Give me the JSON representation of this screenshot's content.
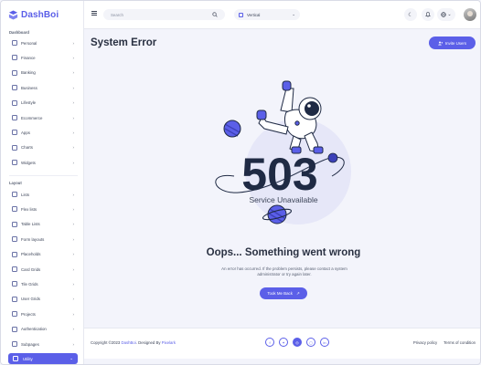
{
  "app": {
    "brand_prefix": "Dash",
    "brand_suffix": "Boi",
    "accent": "#5b5fe8"
  },
  "topbar": {
    "search_placeholder": "Search",
    "layout_value": "Vertical",
    "menu_icon": "hamburger-icon",
    "theme_icon": "moon-icon",
    "notification_icon": "bell-icon",
    "language_icon": "globe-icon"
  },
  "sidebar": {
    "dashboard_title": "Dashboard",
    "dashboard_items": [
      {
        "label": "Personal",
        "icon": "home-icon"
      },
      {
        "label": "Finance",
        "icon": "chart-icon"
      },
      {
        "label": "Banking",
        "icon": "card-icon"
      },
      {
        "label": "Business",
        "icon": "briefcase-icon"
      },
      {
        "label": "Lifestyle",
        "icon": "heart-icon"
      },
      {
        "label": "Ecommerce",
        "icon": "cart-icon"
      },
      {
        "label": "Apps",
        "icon": "grid-icon"
      },
      {
        "label": "Charts",
        "icon": "pie-icon"
      },
      {
        "label": "Widgets",
        "icon": "widget-icon"
      }
    ],
    "layout_title": "Layout",
    "layout_items": [
      {
        "label": "Lists",
        "icon": "list-icon"
      },
      {
        "label": "Flex lists",
        "icon": "flex-icon"
      },
      {
        "label": "Table Lists",
        "icon": "table-icon"
      },
      {
        "label": "Form layouts",
        "icon": "form-icon"
      },
      {
        "label": "Placeholds",
        "icon": "placeholder-icon"
      },
      {
        "label": "Card Grids",
        "icon": "cards-icon"
      },
      {
        "label": "Tile Grids",
        "icon": "tiles-icon"
      },
      {
        "label": "User Grids",
        "icon": "users-icon"
      },
      {
        "label": "Projects",
        "icon": "folder-icon"
      },
      {
        "label": "Authentication",
        "icon": "lock-icon"
      },
      {
        "label": "Subpages",
        "icon": "pages-icon"
      }
    ],
    "active_item": {
      "label": "Utility",
      "icon": "utility-icon"
    }
  },
  "main": {
    "title": "System Error",
    "invite_label": "Invite Users",
    "error_code": "503",
    "error_subtitle": "Service Unavailable",
    "heading": "Oops... Something went wrong",
    "description": "An error has occurred. If the problem persists, please contact a system administrator or try again later.",
    "back_label": "Took Me Back"
  },
  "footer": {
    "copyright_prefix": "Copyright ©2023 ",
    "copyright_brand": "DashBoi",
    "copyright_mid": ". Designed By ",
    "copyright_designer": "Pixelark",
    "social": [
      "facebook-icon",
      "twitter-icon",
      "dribbble-icon",
      "instagram-icon",
      "linkedin-icon"
    ],
    "links": [
      "Privacy policy",
      "Terms of condition"
    ]
  }
}
